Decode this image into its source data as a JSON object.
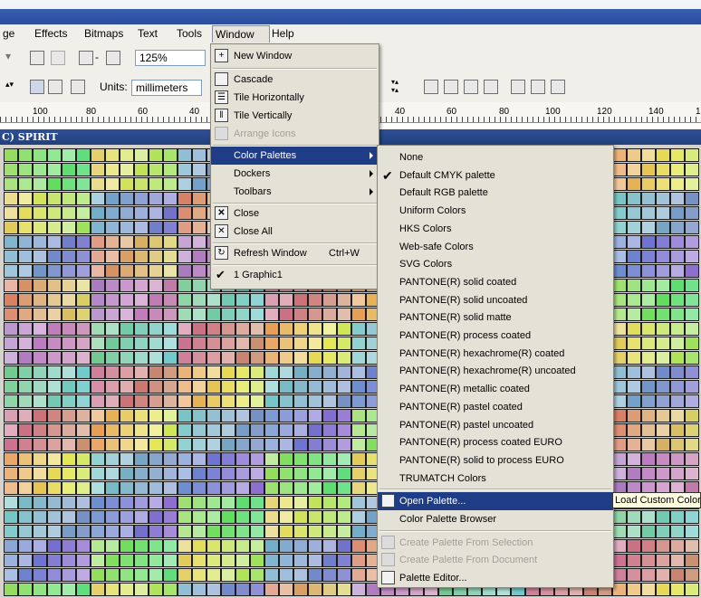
{
  "menubar": {
    "items": [
      "ge",
      "Effects",
      "Bitmaps",
      "Text",
      "Tools",
      "Window",
      "Help"
    ]
  },
  "toolbar": {
    "zoom_value": "125%",
    "units_label": "Units:",
    "units_value": "millimeters"
  },
  "ruler": {
    "ticks": [
      "100",
      "80",
      "60",
      "40",
      "40",
      "60",
      "80",
      "100",
      "120",
      "140",
      "1"
    ]
  },
  "document": {
    "title": "C) SPIRIT"
  },
  "window_menu": {
    "items": [
      {
        "label": "New Window",
        "icon": "new-window-icon"
      },
      {
        "label": "Cascade",
        "icon": "cascade-icon"
      },
      {
        "label": "Tile Horizontally",
        "icon": "tile-horizontal-icon"
      },
      {
        "label": "Tile Vertically",
        "icon": "tile-vertical-icon"
      },
      {
        "label": "Arrange Icons",
        "icon": "arrange-icons-icon",
        "disabled": true
      },
      {
        "label": "Color Palettes",
        "submenu": true,
        "highlighted": true
      },
      {
        "label": "Dockers",
        "submenu": true
      },
      {
        "label": "Toolbars",
        "submenu": true
      },
      {
        "label": "Close",
        "icon": "close-icon"
      },
      {
        "label": "Close All",
        "icon": "close-all-icon"
      },
      {
        "label": "Refresh Window",
        "icon": "refresh-icon",
        "shortcut": "Ctrl+W"
      },
      {
        "label": "1 Graphic1",
        "checked": true
      }
    ]
  },
  "palettes_menu": {
    "items": [
      {
        "label": "None"
      },
      {
        "label": "Default CMYK palette",
        "checked": true
      },
      {
        "label": "Default RGB palette"
      },
      {
        "label": "Uniform Colors"
      },
      {
        "label": "HKS Colors"
      },
      {
        "label": "Web-safe Colors"
      },
      {
        "label": "SVG Colors"
      },
      {
        "label": "PANTONE(R) solid coated"
      },
      {
        "label": "PANTONE(R) solid uncoated"
      },
      {
        "label": "PANTONE(R) solid matte"
      },
      {
        "label": "PANTONE(R) process coated"
      },
      {
        "label": "PANTONE(R) hexachrome(R) coated"
      },
      {
        "label": "PANTONE(R) hexachrome(R) uncoated"
      },
      {
        "label": "PANTONE(R) metallic coated"
      },
      {
        "label": "PANTONE(R) pastel coated"
      },
      {
        "label": "PANTONE(R) pastel uncoated"
      },
      {
        "label": "PANTONE(R) process coated EURO"
      },
      {
        "label": "PANTONE(R) solid to process EURO"
      },
      {
        "label": "TRUMATCH Colors"
      },
      {
        "label": "Open Palette...",
        "icon": "open-palette-icon",
        "highlighted": true
      },
      {
        "label": "Color Palette Browser"
      },
      {
        "label": "Create Palette From Selection",
        "icon": "palette-selection-icon",
        "disabled": true
      },
      {
        "label": "Create Palette From Document",
        "icon": "palette-document-icon",
        "disabled": true
      },
      {
        "label": "Palette Editor...",
        "icon": "palette-editor-icon"
      }
    ]
  },
  "tooltip": {
    "text": "Load Custom Colors"
  },
  "colors": {
    "menu_highlight": "#1e3d86",
    "document_titlebar": "#21407d",
    "menu_background": "#e4e1d7"
  }
}
